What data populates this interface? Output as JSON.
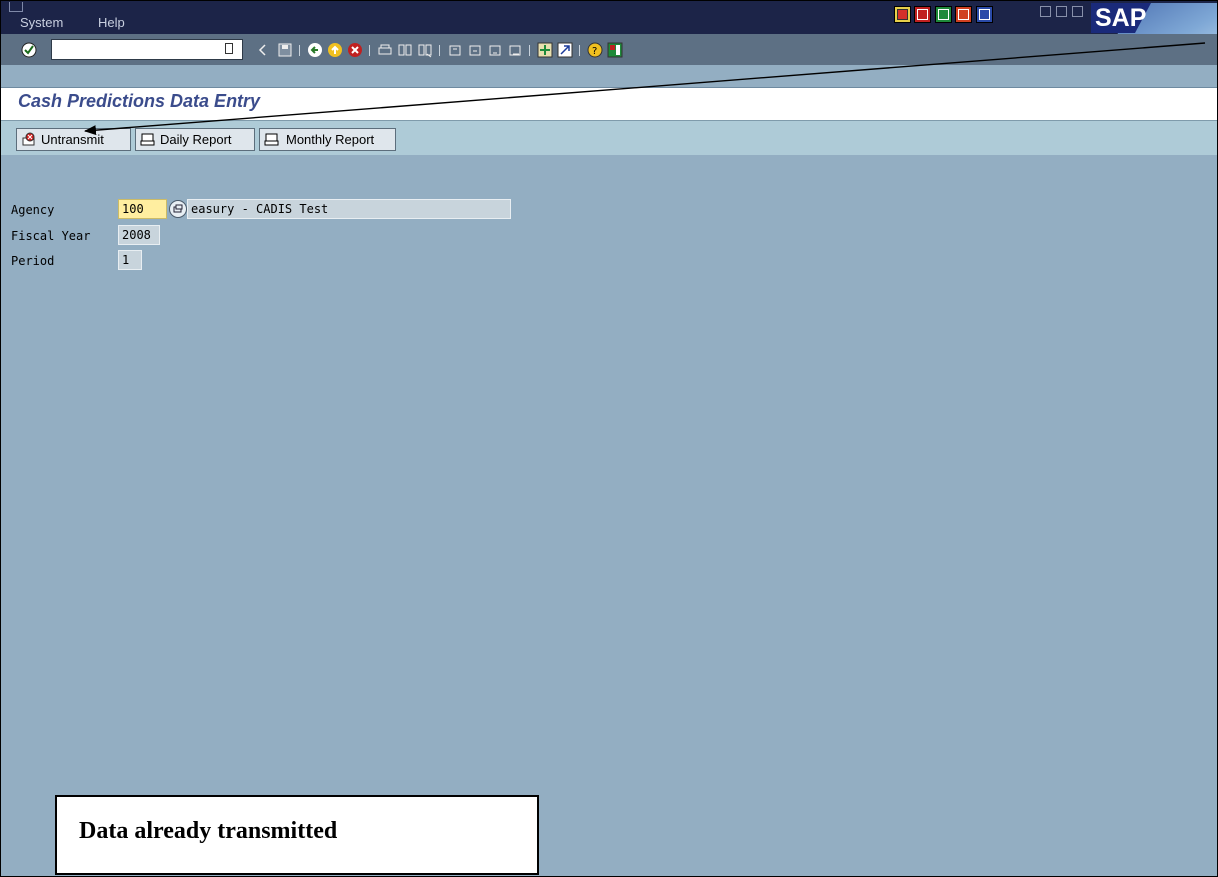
{
  "menu": {
    "items": [
      "System",
      "Help"
    ]
  },
  "brand": {
    "logo_text": "SAP"
  },
  "toolbar": {
    "command_field_value": "",
    "icons": [
      "enter-icon",
      "back-icon",
      "save-icon",
      "go-back-icon",
      "exit-icon",
      "cancel-icon",
      "print-icon",
      "find-icon",
      "find-next-icon",
      "first-page-icon",
      "previous-page-icon",
      "next-page-icon",
      "last-page-icon",
      "create-session-icon",
      "shortcut-icon",
      "help-icon",
      "layout-icon"
    ]
  },
  "screen": {
    "title": "Cash Predictions Data Entry"
  },
  "app_toolbar": {
    "buttons": [
      {
        "label": "Untransmit",
        "icon": "untransmit-icon"
      },
      {
        "label": "Daily Report",
        "icon": "printer-icon"
      },
      {
        "label": "Monthly Report",
        "icon": "printer-icon"
      }
    ]
  },
  "form": {
    "agency": {
      "label": "Agency",
      "value": "100",
      "description": "easury - CADIS Test"
    },
    "fiscal_year": {
      "label": "Fiscal Year",
      "value": "2008"
    },
    "period": {
      "label": "Period",
      "value": "1"
    }
  },
  "callout": {
    "text": "Data already transmitted"
  },
  "colors": {
    "menubar": "#1c2448",
    "toolbar": "#5d7084",
    "background": "#93aec2",
    "app_toolbar": "#aecbd7",
    "title_text": "#3b4c8c",
    "input_active": "#ffeea0"
  }
}
